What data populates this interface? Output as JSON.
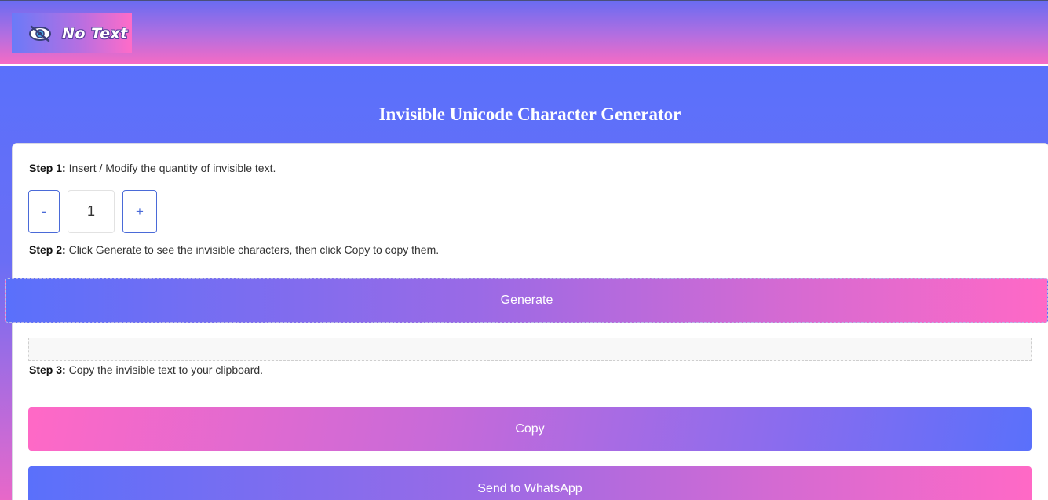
{
  "header": {
    "logo_text": "No Text",
    "logo_icon": "eye-icon"
  },
  "page": {
    "title": "Invisible Unicode Character Generator"
  },
  "step1": {
    "label": "Step 1:",
    "text": " Insert / Modify the quantity of invisible text."
  },
  "quantity": {
    "minus_label": "-",
    "value": "1",
    "plus_label": "+"
  },
  "step2": {
    "label": "Step 2:",
    "text": " Click Generate to see the invisible characters, then click Copy to copy them."
  },
  "generate": {
    "label": "Generate"
  },
  "output": {
    "value": ""
  },
  "step3": {
    "label": "Step 3:",
    "text": " Copy the invisible text to your clipboard."
  },
  "copy": {
    "label": "Copy"
  },
  "whatsapp": {
    "label": "Send to WhatsApp"
  },
  "colors": {
    "accent_blue": "#5a70fb",
    "accent_pink": "#ff69c6",
    "border_blue": "#4a6ad8"
  }
}
